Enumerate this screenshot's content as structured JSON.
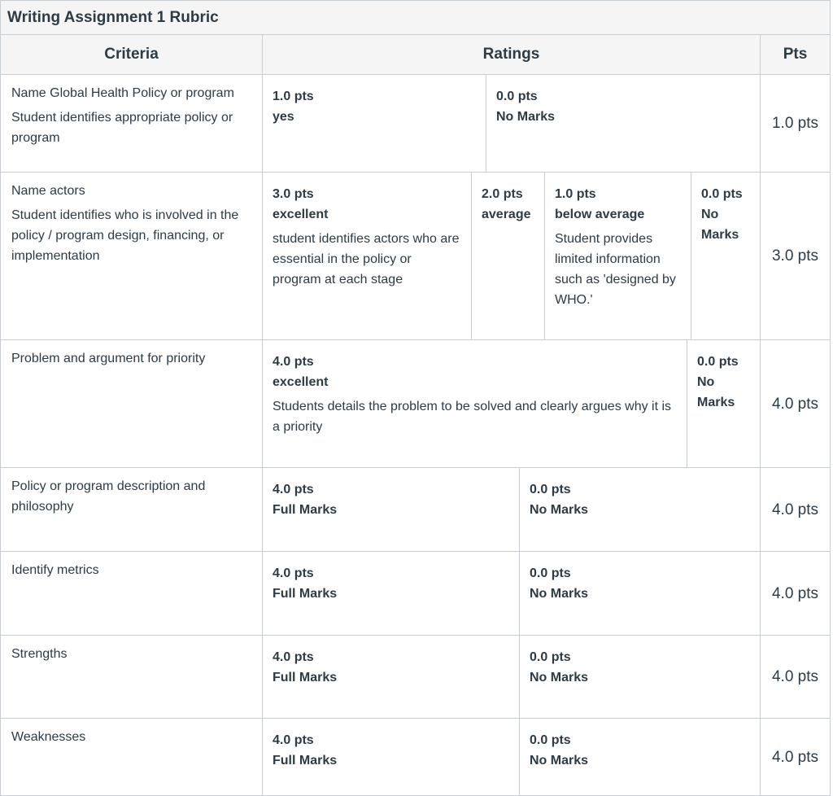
{
  "title": "Writing Assignment 1 Rubric",
  "headers": {
    "criteria": "Criteria",
    "ratings": "Ratings",
    "pts": "Pts"
  },
  "rows": [
    {
      "criterion": "Name Global Health Policy or program",
      "description": "Student identifies appropriate policy or program",
      "ratings": [
        {
          "pts": "1.0 pts",
          "label": "yes",
          "description": ""
        },
        {
          "pts": "0.0 pts",
          "label": "No Marks",
          "description": ""
        }
      ],
      "points": "1.0 pts"
    },
    {
      "criterion": "Name actors",
      "description": "Student identifies who is involved in the policy / program design, financing, or implementation",
      "ratings": [
        {
          "pts": "3.0 pts",
          "label": "excellent",
          "description": "student identifies actors who are essential in the policy or program at each stage"
        },
        {
          "pts": "2.0 pts",
          "label": "average",
          "description": ""
        },
        {
          "pts": "1.0 pts",
          "label": "below average",
          "description": "Student provides limited information such as 'designed by WHO.'"
        },
        {
          "pts": "0.0 pts",
          "label": "No Marks",
          "description": ""
        }
      ],
      "points": "3.0 pts"
    },
    {
      "criterion": "Problem and argument for priority",
      "description": "",
      "ratings": [
        {
          "pts": "4.0 pts",
          "label": "excellent",
          "description": "Students details the problem to be solved and clearly argues why it is a priority"
        },
        {
          "pts": "0.0 pts",
          "label": "No Marks",
          "description": ""
        }
      ],
      "points": "4.0 pts"
    },
    {
      "criterion": "Policy or program description and philosophy",
      "description": "",
      "ratings": [
        {
          "pts": "4.0 pts",
          "label": "Full Marks",
          "description": ""
        },
        {
          "pts": "0.0 pts",
          "label": "No Marks",
          "description": ""
        }
      ],
      "points": "4.0 pts"
    },
    {
      "criterion": "Identify metrics",
      "description": "",
      "ratings": [
        {
          "pts": "4.0 pts",
          "label": "Full Marks",
          "description": ""
        },
        {
          "pts": "0.0 pts",
          "label": "No Marks",
          "description": ""
        }
      ],
      "points": "4.0 pts"
    },
    {
      "criterion": "Strengths",
      "description": "",
      "ratings": [
        {
          "pts": "4.0 pts",
          "label": "Full Marks",
          "description": ""
        },
        {
          "pts": "0.0 pts",
          "label": "No Marks",
          "description": ""
        }
      ],
      "points": "4.0 pts"
    },
    {
      "criterion": "Weaknesses",
      "description": "",
      "ratings": [
        {
          "pts": "4.0 pts",
          "label": "Full Marks",
          "description": ""
        },
        {
          "pts": "0.0 pts",
          "label": "No Marks",
          "description": ""
        }
      ],
      "points": "4.0 pts"
    }
  ]
}
